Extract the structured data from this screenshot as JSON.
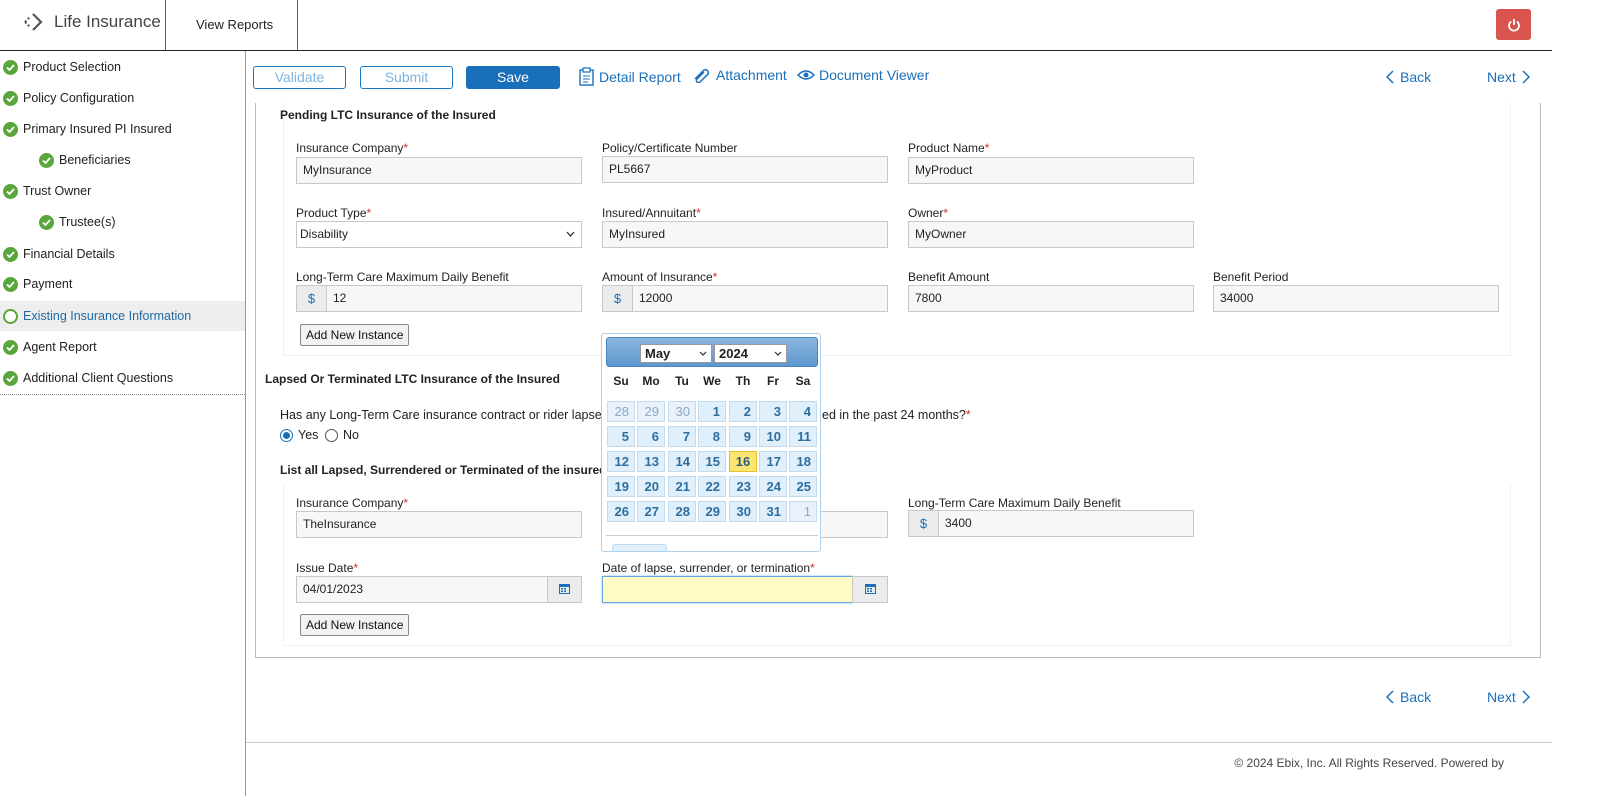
{
  "header": {
    "app_title": "Life Insurance",
    "view_reports": "View Reports"
  },
  "sidebar": {
    "items": [
      {
        "label": "Product Selection"
      },
      {
        "label": "Policy Configuration"
      },
      {
        "label": "Primary Insured PI Insured"
      },
      {
        "label": "Beneficiaries"
      },
      {
        "label": "Trust Owner"
      },
      {
        "label": "Trustee(s)"
      },
      {
        "label": "Financial Details"
      },
      {
        "label": "Payment"
      },
      {
        "label": "Existing Insurance Information"
      },
      {
        "label": "Agent Report"
      },
      {
        "label": "Additional Client Questions"
      }
    ]
  },
  "toolbar": {
    "validate": "Validate",
    "submit": "Submit",
    "save": "Save",
    "detail_report": "Detail Report",
    "attachment": "Attachment",
    "document_viewer": "Document Viewer",
    "back": "Back",
    "next": "Next"
  },
  "pending": {
    "title": "Pending LTC Insurance of the Insured",
    "insurance_company_label": "Insurance Company",
    "insurance_company_value": "MyInsurance",
    "policy_number_label": "Policy/Certificate Number",
    "policy_number_value": "PL5667",
    "product_name_label": "Product Name",
    "product_name_value": "MyProduct",
    "product_type_label": "Product Type",
    "product_type_value": "Disability",
    "insured_label": "Insured/Annuitant",
    "insured_value": "MyInsured",
    "owner_label": "Owner",
    "owner_value": "MyOwner",
    "ltc_max_label": "Long-Term Care Maximum Daily Benefit",
    "ltc_max_value": "12",
    "amount_label": "Amount of Insurance",
    "amount_value": "12000",
    "benefit_amount_label": "Benefit Amount",
    "benefit_amount_value": "7800",
    "benefit_period_label": "Benefit Period",
    "benefit_period_value": "34000",
    "add_new": "Add New Instance",
    "currency": "$",
    "required_mark": "*"
  },
  "lapsed": {
    "title": "Lapsed Or Terminated LTC Insurance of the Insured",
    "question_start": "Has any Long-Term Care insurance contract or rider lapsed,",
    "question_end": "ed in the past 24 months?",
    "yes": "Yes",
    "no": "No",
    "list_title": "List all Lapsed, Surrendered or Terminated of the insured",
    "insurance_company_label": "Insurance Company",
    "insurance_company_value": "TheInsurance",
    "ltc_max_label": "Long-Term Care Maximum Daily Benefit",
    "ltc_max_value": "3400",
    "issue_date_label": "Issue Date",
    "issue_date_value": "04/01/2023",
    "lapse_date_label": "Date of lapse, surrender, or termination",
    "lapse_date_value": "",
    "add_new": "Add New Instance"
  },
  "datepicker": {
    "month": "May",
    "year": "2024",
    "dow": [
      "Su",
      "Mo",
      "Tu",
      "We",
      "Th",
      "Fr",
      "Sa"
    ],
    "weeks": [
      [
        "28",
        "29",
        "30",
        "1",
        "2",
        "3",
        "4"
      ],
      [
        "5",
        "6",
        "7",
        "8",
        "9",
        "10",
        "11"
      ],
      [
        "12",
        "13",
        "14",
        "15",
        "16",
        "17",
        "18"
      ],
      [
        "19",
        "20",
        "21",
        "22",
        "23",
        "24",
        "25"
      ],
      [
        "26",
        "27",
        "28",
        "29",
        "30",
        "31",
        "1"
      ]
    ],
    "today": "16"
  },
  "footer": {
    "back": "Back",
    "next": "Next",
    "copyright": "© 2024 Ebix, Inc. All Rights Reserved. Powered by"
  }
}
